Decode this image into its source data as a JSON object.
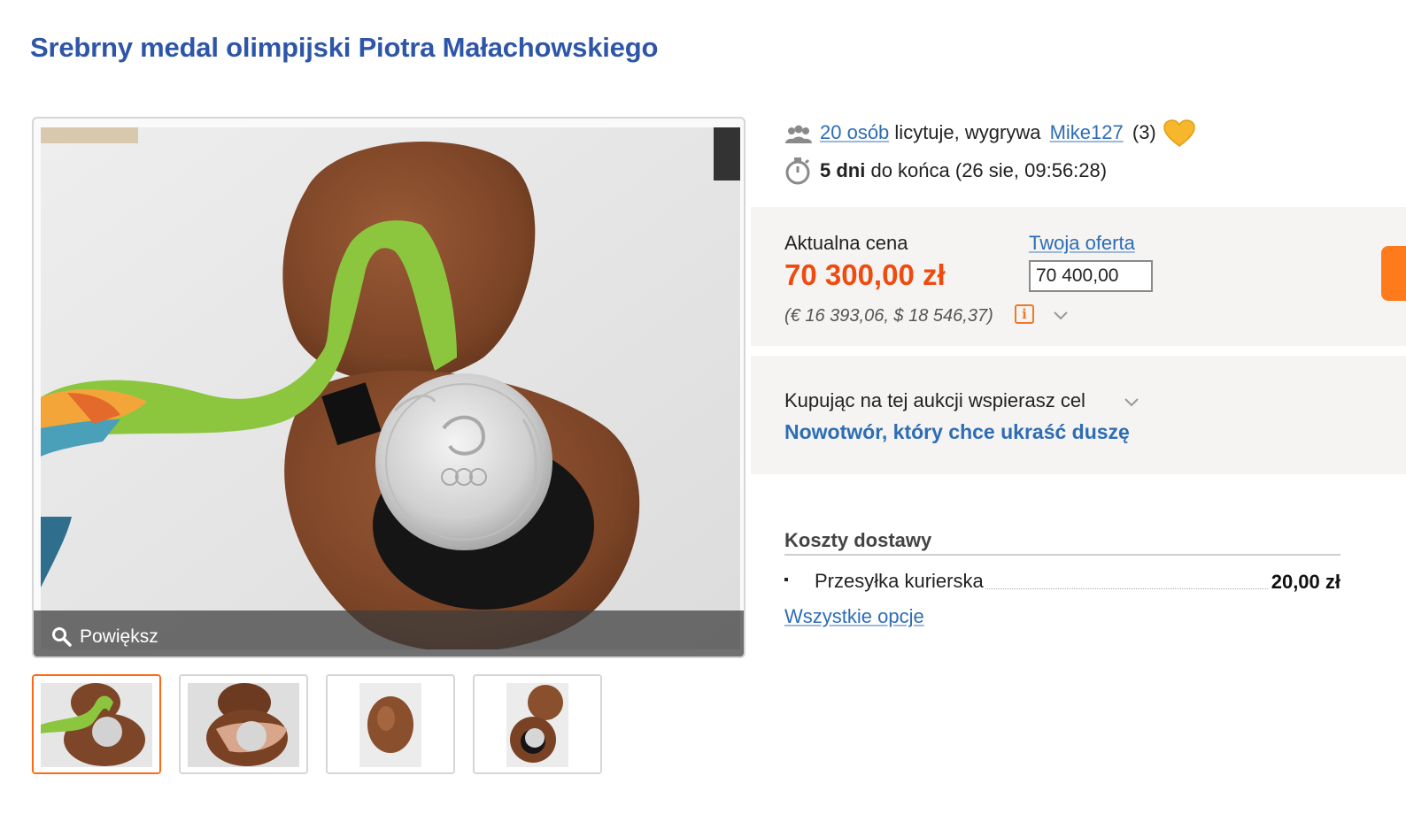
{
  "title": "Srebrny medal olimpijski Piotra Małachowskiego",
  "gallery": {
    "zoom_label": "Powiększ",
    "thumbnails": [
      "medal-open-case",
      "medal-in-hand",
      "closed-case",
      "case-with-medal"
    ]
  },
  "bidding": {
    "bidders_link": "20 osób",
    "bidders_text": "licytuje, wygrywa",
    "winner": "Mike127",
    "winner_rating": "(3)",
    "time_left": "5 dni",
    "time_text": "do końca (26 sie, 09:56:28)"
  },
  "price": {
    "label": "Aktualna cena",
    "value": "70 300,00 zł",
    "conversion": "(€ 16 393,06, $ 18 546,37)",
    "info_icon": "i",
    "offer_label": "Twoja oferta",
    "offer_value": "70 400,00"
  },
  "charity": {
    "label": "Kupując na tej aukcji wspierasz cel",
    "cause": "Nowotwór, który chce ukraść duszę"
  },
  "shipping": {
    "heading": "Koszty dostawy",
    "method": "Przesyłka kurierska",
    "cost": "20,00 zł",
    "all_options": "Wszystkie opcje"
  },
  "colors": {
    "title": "#2e56a8",
    "link": "#2d6db5",
    "price": "#ef4b10",
    "accent": "#ff6a16",
    "heart": "#f6b72c"
  }
}
